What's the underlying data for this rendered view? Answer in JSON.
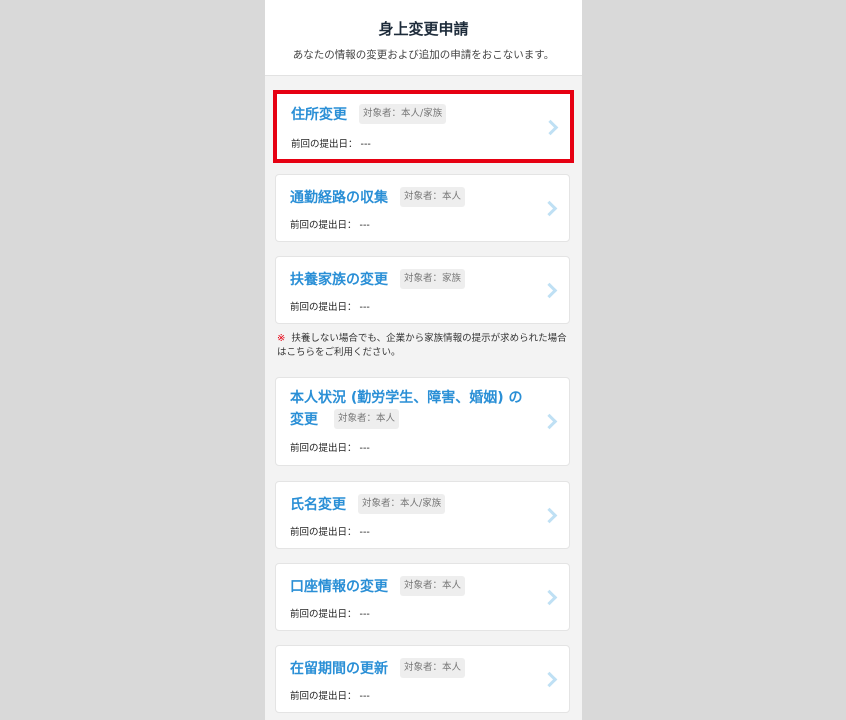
{
  "header": {
    "title": "身上変更申請",
    "subtitle": "あなたの情報の変更および追加の申請をおこないます。"
  },
  "date_label": "前回の提出日：",
  "date_value": "---",
  "items": [
    {
      "title": "住所変更",
      "badge": "対象者：本人/家族",
      "highlighted": true
    },
    {
      "title": "通勤経路の収集",
      "badge": "対象者：本人"
    },
    {
      "title": "扶養家族の変更",
      "badge": "対象者：家族"
    },
    {
      "title_line1": "本人状況 (勤労学生、障害、婚姻) の",
      "title_line2": "変更",
      "badge": "対象者：本人"
    },
    {
      "title": "氏名変更",
      "badge": "対象者：本人/家族"
    },
    {
      "title": "口座情報の変更",
      "badge": "対象者：本人"
    },
    {
      "title": "在留期間の更新",
      "badge": "対象者：本人"
    }
  ],
  "note": {
    "mark": "※",
    "text": "扶養しない場合でも、企業から家族情報の提示が求められた場合はこちらをご利用ください。"
  }
}
